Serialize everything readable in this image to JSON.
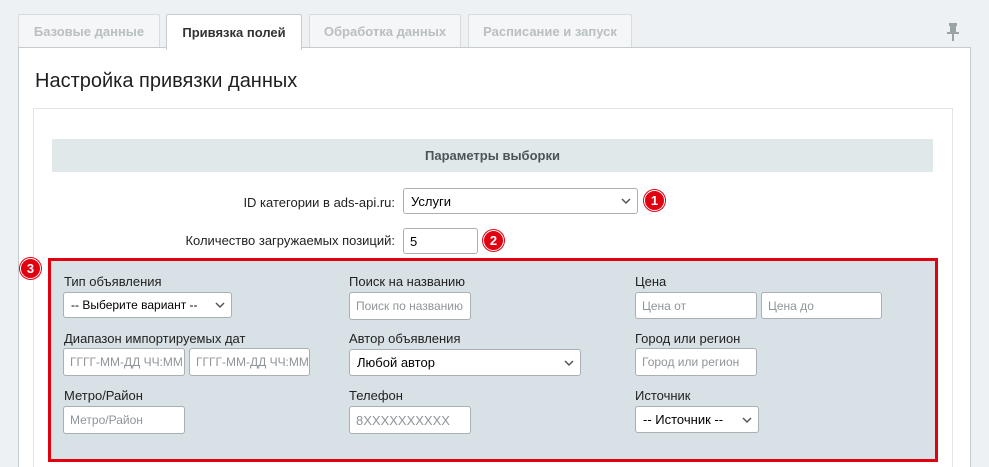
{
  "tabs": [
    {
      "label": "Базовые данные",
      "active": false
    },
    {
      "label": "Привязка полей",
      "active": true
    },
    {
      "label": "Обработка данных",
      "active": false
    },
    {
      "label": "Расписание и запуск",
      "active": false
    }
  ],
  "panel": {
    "title": "Настройка привязки данных",
    "section_header": "Параметры выборки"
  },
  "category": {
    "label": "ID категории в ads-api.ru:",
    "value": "Услуги",
    "badge": "1"
  },
  "count": {
    "label": "Количество загружаемых позиций:",
    "value": "5",
    "badge": "2"
  },
  "filters": {
    "badge": "3",
    "ad_type": {
      "label": "Тип объявления",
      "value": "-- Выберите вариант --"
    },
    "title_search": {
      "label": "Поиск на названию",
      "placeholder": "Поиск по названию"
    },
    "price": {
      "label": "Цена",
      "from_placeholder": "Цена от",
      "to_placeholder": "Цена до"
    },
    "date_range": {
      "label": "Диапазон импортируемых дат",
      "from_placeholder": "ГГГГ-ММ-ДД ЧЧ:ММ",
      "to_placeholder": "ГГГГ-ММ-ДД ЧЧ:ММ"
    },
    "author": {
      "label": "Автор объявления",
      "value": "Любой автор"
    },
    "city": {
      "label": "Город или регион",
      "placeholder": "Город или регион"
    },
    "metro": {
      "label": "Метро/Район",
      "placeholder": "Метро/Район"
    },
    "phone": {
      "label": "Телефон",
      "placeholder": "8XXXXXXXXXX"
    },
    "source": {
      "label": "Источник",
      "value": "-- Источник --"
    }
  },
  "colors": {
    "accent_red": "#e00010",
    "filter_bg": "#d8e1e5",
    "header_bg": "#e0e8ea"
  },
  "icons": {
    "pin": "pin-icon",
    "select_arrow": "chevron-down-icon"
  }
}
